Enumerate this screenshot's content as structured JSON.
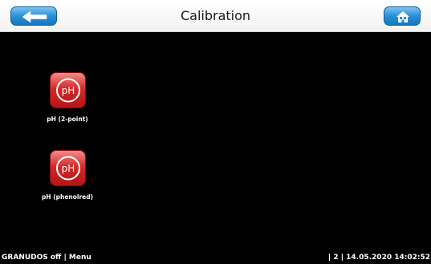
{
  "header": {
    "title": "Calibration",
    "back_icon": "arrow-left-icon",
    "home_icon": "home-icon",
    "accent_color": "#1f86cf"
  },
  "items": [
    {
      "icon_text": "pH",
      "label": "pH (2-point)",
      "color": "#d42a2a"
    },
    {
      "icon_text": "pH",
      "label": "pH (phenolred)",
      "color": "#d42a2a"
    }
  ],
  "status": {
    "left": "GRANUDOS off | Menu",
    "right": "| 2 | 14.05.2020 14:02:52"
  }
}
